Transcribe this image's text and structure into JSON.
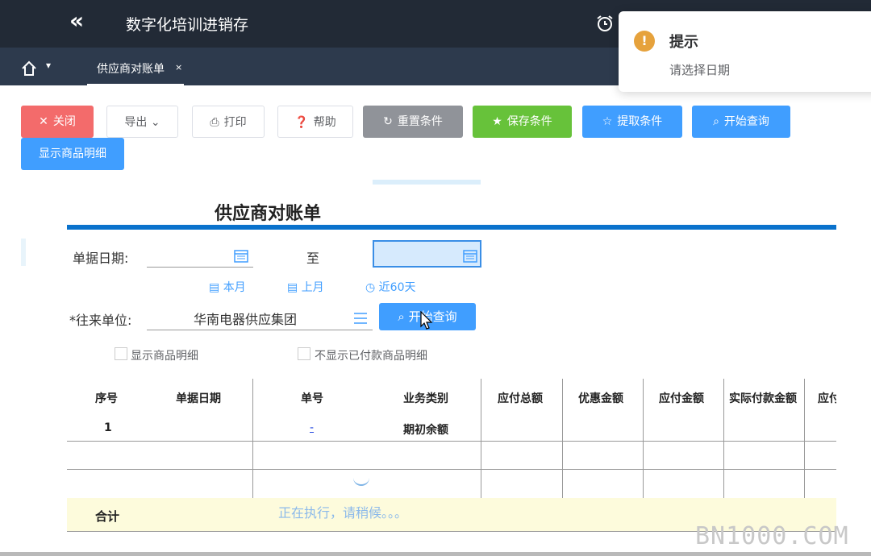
{
  "app": {
    "title": "数字化培训进销存"
  },
  "tabs": [
    {
      "label": "供应商对账单",
      "close": "×"
    }
  ],
  "toast": {
    "icon": "!",
    "title": "提示",
    "message": "请选择日期",
    "color": "#e6a23c"
  },
  "toolbar": {
    "close": "关闭",
    "export": "导出",
    "print": "打印",
    "help": "帮助",
    "reset": "重置条件",
    "save": "保存条件",
    "fetch": "提取条件",
    "query": "开始查询",
    "show_details": "显示商品明细"
  },
  "report": {
    "title": "供应商对账单",
    "date_label": "单据日期:",
    "to": "至",
    "quick": {
      "this_month": "本月",
      "last_month": "上月",
      "last60": "近60天"
    },
    "partner_label": "*往来单位:",
    "partner_value": "华南电器供应集团",
    "query_button": "开始查询",
    "checkbox_show": "显示商品明细",
    "checkbox_hide_paid": "不显示已付款商品明细"
  },
  "grid": {
    "headers": [
      "序号",
      "单据日期",
      "单号",
      "业务类别",
      "应付总额",
      "优惠金额",
      "应付金额",
      "实际付款金额",
      "应付"
    ],
    "rows": [
      {
        "seq": "1",
        "date": "",
        "no": "-",
        "type": "期初余额"
      }
    ],
    "total_label": "合计"
  },
  "loading": "正在执行，请稍候。。。",
  "watermark": "BN1000.COM",
  "colors": {
    "primary": "#409eff",
    "danger": "#f36b6b",
    "success": "#67c23a",
    "info": "#909399",
    "header_bg": "#222a36",
    "tab_bg": "#2d3a4d",
    "rule": "#0a72cc"
  }
}
